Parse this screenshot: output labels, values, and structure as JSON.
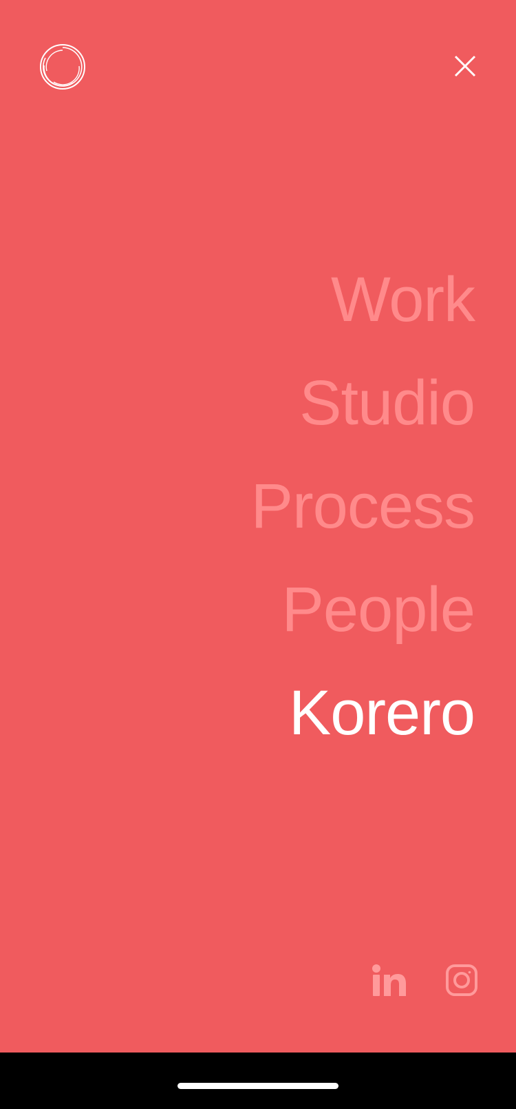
{
  "app": {
    "background_color": "#F05B5E",
    "muted_text_color": "#FF8A8B",
    "active_text_color": "#FFFFFF"
  },
  "header": {
    "logo_icon": "ring-logo-icon",
    "close_icon": "close-icon"
  },
  "nav": {
    "items": [
      {
        "label": "Work",
        "active": false
      },
      {
        "label": "Studio",
        "active": false
      },
      {
        "label": "Process",
        "active": false
      },
      {
        "label": "People",
        "active": false
      },
      {
        "label": "Korero",
        "active": true
      }
    ]
  },
  "socials": {
    "items": [
      {
        "icon": "linkedin-icon"
      },
      {
        "icon": "instagram-icon"
      }
    ]
  }
}
